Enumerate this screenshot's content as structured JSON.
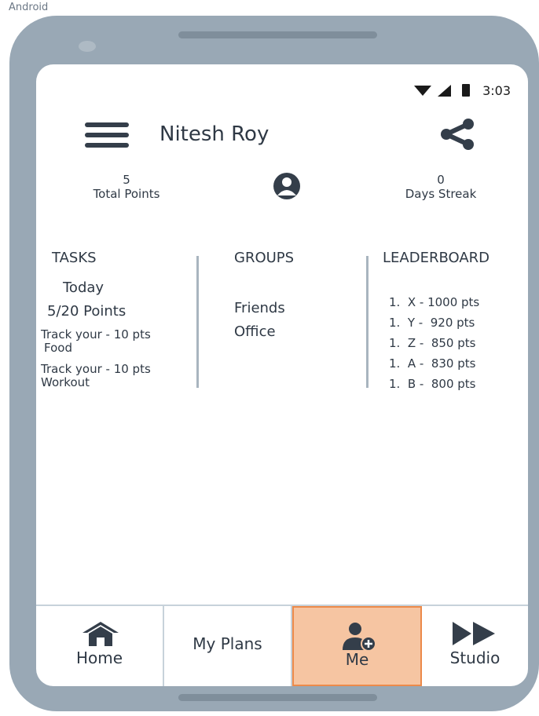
{
  "frame_label": "Android",
  "status_bar": {
    "time": "3:03"
  },
  "header": {
    "title": "Nitesh Roy"
  },
  "stats": {
    "total_points_value": "5",
    "total_points_label": "Total Points",
    "streak_value": "0",
    "streak_label": "Days Streak"
  },
  "tasks": {
    "heading": "TASKS",
    "today_label": "Today",
    "points_progress": "5/20 Points",
    "items": [
      {
        "line1": "Track your - 10 pts",
        "line2": "Food"
      },
      {
        "line1": "Track your - 10 pts",
        "line2": "Workout"
      }
    ]
  },
  "groups": {
    "heading": "GROUPS",
    "items": [
      "Friends",
      "Office"
    ]
  },
  "leaderboard": {
    "heading": "LEADERBOARD",
    "items": [
      "1.  X - 1000 pts",
      "1.  Y -  920 pts",
      "1.  Z -  850 pts",
      "1.  A -  830 pts",
      "1.  B -  800 pts"
    ]
  },
  "bottom_nav": {
    "items": [
      {
        "label": "Home",
        "icon": "home-icon"
      },
      {
        "label": "My Plans"
      },
      {
        "label": "Me",
        "icon": "add-user-icon",
        "active": true
      },
      {
        "label": "Studio",
        "icon": "fast-forward-icon"
      }
    ],
    "active_color": "#f6c5a2",
    "active_border_color": "#ec8a4a"
  }
}
